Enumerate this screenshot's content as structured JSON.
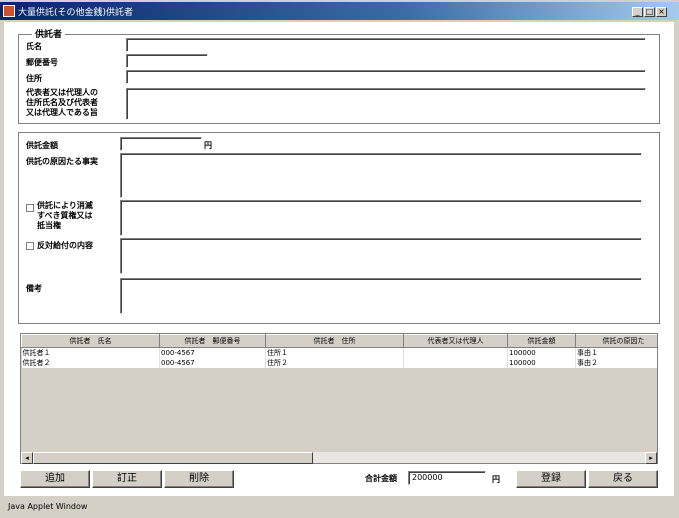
{
  "window": {
    "title": "大量供託(その他金銭)供託者",
    "minimize": "_",
    "maximize": "□",
    "close": "×"
  },
  "depositor": {
    "legend": "供託者",
    "name_label": "氏名",
    "postal_label": "郵便番号",
    "address_label": "住所",
    "representative_label_1": "代表者又は代理人の",
    "representative_label_2": "住所氏名及び代表者",
    "representative_label_3": "又は代理人である旨",
    "name_value": "",
    "postal_value": "",
    "address_value": "",
    "representative_value": ""
  },
  "deposit": {
    "amount_label": "供託金額",
    "amount_value": "",
    "amount_unit": "円",
    "cause_label": "供託の原因たる事実",
    "cause_value": "",
    "extinguish_label_1": "供託により消滅",
    "extinguish_label_2": "すべき質権又は",
    "extinguish_label_3": "抵当権",
    "extinguish_value": "",
    "counter_label": "反対給付の内容",
    "counter_value": "",
    "remarks_label": "備考",
    "remarks_value": ""
  },
  "table": {
    "columns": [
      "供託者　氏名",
      "供託者　郵便番号",
      "供託者　住所",
      "代表者又は代理人",
      "供託金額",
      "供託の原因た"
    ],
    "rows": [
      [
        "供託者１",
        "000-4567",
        "住所１",
        "",
        "100000",
        "事由１"
      ],
      [
        "供託者２",
        "000-4567",
        "住所２",
        "",
        "100000",
        "事由２"
      ]
    ],
    "scroll_left": "◂",
    "scroll_right": "▸"
  },
  "actions": {
    "add": "追加",
    "edit": "訂正",
    "delete": "削除",
    "total_label": "合計金額",
    "total_value": "200000",
    "total_unit": "円",
    "register": "登録",
    "back": "戻る"
  },
  "status": {
    "text": "Java Applet Window"
  },
  "colors": {
    "titlebar": "#0a246a",
    "face": "#d4d0c8"
  }
}
